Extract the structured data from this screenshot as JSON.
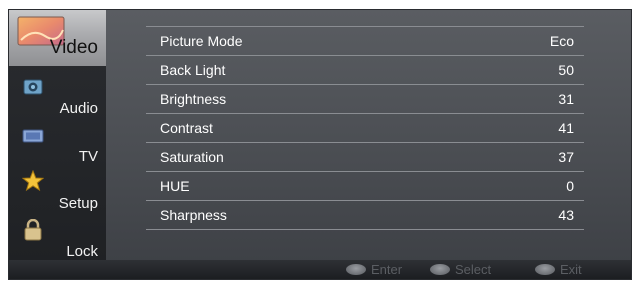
{
  "sidebar": {
    "items": [
      {
        "label": "Video",
        "icon": "video-icon",
        "active": true
      },
      {
        "label": "Audio",
        "icon": "audio-icon",
        "active": false
      },
      {
        "label": "TV",
        "icon": "tv-icon",
        "active": false
      },
      {
        "label": "Setup",
        "icon": "setup-star-icon",
        "active": false
      },
      {
        "label": "Lock",
        "icon": "lock-icon",
        "active": false
      }
    ]
  },
  "settings": {
    "rows": [
      {
        "name": "Picture Mode",
        "value": "Eco"
      },
      {
        "name": "Back Light",
        "value": "50"
      },
      {
        "name": "Brightness",
        "value": "31"
      },
      {
        "name": "Contrast",
        "value": "41"
      },
      {
        "name": "Saturation",
        "value": "37"
      },
      {
        "name": "HUE",
        "value": "0"
      },
      {
        "name": "Sharpness",
        "value": "43"
      }
    ]
  },
  "footer": {
    "enter_label": "Enter",
    "select_label": "Select",
    "exit_label": "Exit"
  },
  "colors": {
    "panel": "#4a4d52",
    "sidebar": "#232528",
    "active_tab": "#b4b5b8",
    "text": "#ffffff",
    "divider": "#8a8d92",
    "hint_text": "#5b5e63"
  }
}
